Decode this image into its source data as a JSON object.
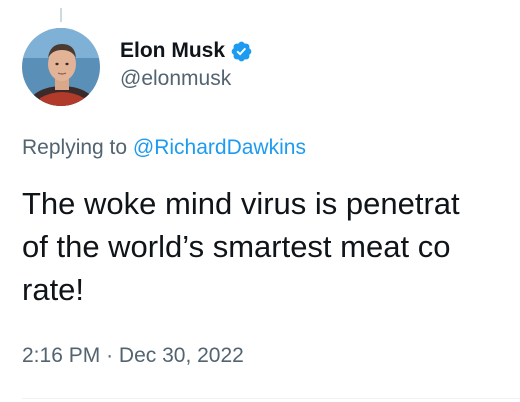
{
  "tweet": {
    "author": {
      "display_name": "Elon Musk",
      "handle": "@elonmusk",
      "verified": true,
      "avatar_icon": "profile-photo"
    },
    "reply": {
      "prefix": "Replying to",
      "to_handle": "@RichardDawkins"
    },
    "text_lines": [
      "The woke mind virus is penetrat",
      "of the world’s smartest meat co",
      "rate!"
    ],
    "time": "2:16 PM",
    "separator": "·",
    "date": "Dec 30, 2022"
  },
  "colors": {
    "text": "#0f1419",
    "secondary": "#536471",
    "link": "#1d9bf0",
    "verified_badge": "#1d9bf0"
  }
}
